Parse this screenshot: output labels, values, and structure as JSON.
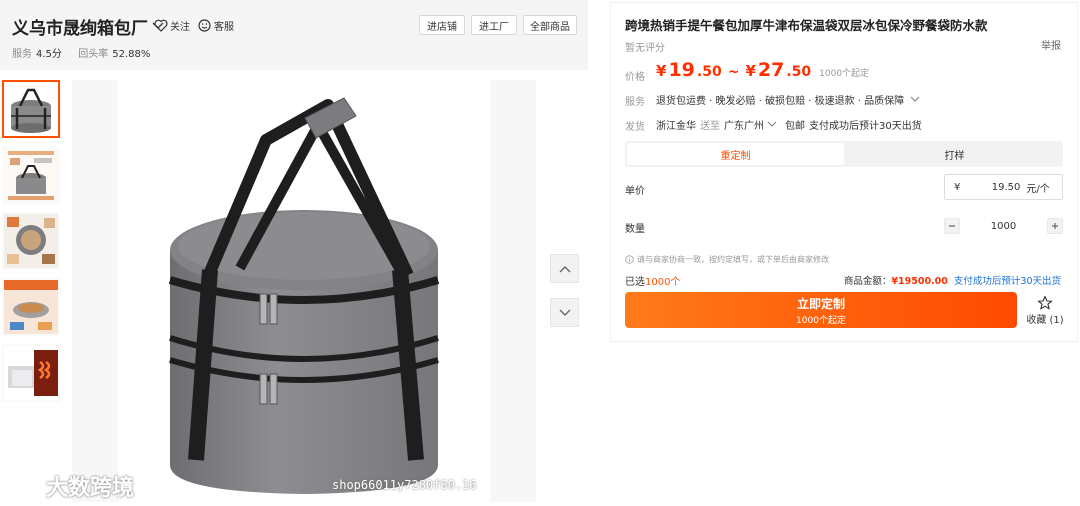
{
  "shop": {
    "name": "义乌市晟绚箱包厂",
    "follow": "关注",
    "service": "客服",
    "stats": {
      "service_label": "服务",
      "service_value": "4.5分",
      "repurchase_label": "回头率",
      "repurchase_value": "52.88%"
    },
    "buttons": {
      "enter_shop": "进店铺",
      "enter_factory": "进工厂",
      "all_products": "全部商品"
    }
  },
  "gallery": {
    "watermark_brand": "大数跨境",
    "watermark_shop": "shop66011y7280f60.16"
  },
  "product": {
    "title": "跨境热销手提午餐包加厚牛津布保温袋双层冰包保冷野餐袋防水款",
    "rating": "暂无评分",
    "report": "举报",
    "price_label": "价格",
    "price_min_int": "19",
    "price_min_dec": ".50",
    "price_max_int": "27",
    "price_max_dec": ".50",
    "currency": "¥",
    "tilde": "~",
    "moq": "1000个起定",
    "service_label": "服务",
    "services": "退货包运费 · 晚发必赔 · 破损包赔 · 极速退款 · 品质保障",
    "ship_label": "发货",
    "ship_from": "浙江金华",
    "ship_to_label": "送至",
    "ship_to": "广东广州",
    "shipping": "包邮",
    "ship_time": "支付成功后预计30天出货",
    "tabs": [
      "重定制",
      "打样"
    ],
    "unit_price_label": "单价",
    "unit_price_currency": "¥",
    "unit_price_value": "19.50",
    "unit_price_unit": "元/个",
    "qty_label": "数量",
    "qty_value": "1000",
    "note": "请与商家协商一致，按约定填写，或下单后由商家修改",
    "selected_prefix": "已选",
    "selected_count": "1000个",
    "total_label": "商品金额：",
    "total_value": "¥19500.00",
    "total_delivery": "支付成功后预计30天出货",
    "buy_label": "立即定制",
    "buy_sub": "1000个起定",
    "fav_label": "收藏 (1)"
  },
  "colors": {
    "accent": "#ff5000",
    "price": "#ff3000",
    "link": "#1a6fd9"
  }
}
